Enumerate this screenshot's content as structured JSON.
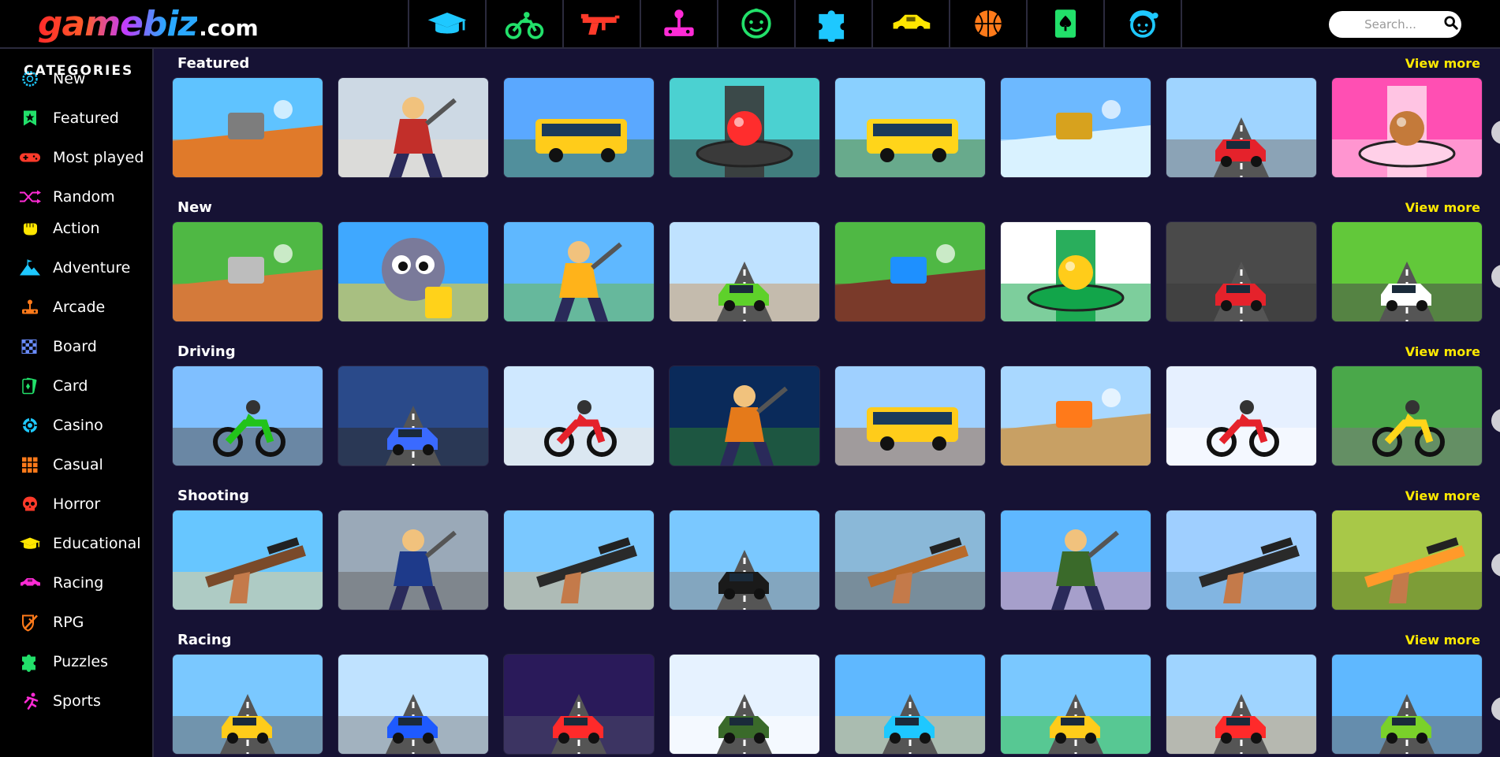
{
  "brand": {
    "name": "gamebiz",
    "suffix": ".com"
  },
  "top_nav": [
    {
      "name": "educational",
      "icon": "graduation-cap-icon",
      "color": "#1ec8ff"
    },
    {
      "name": "driving",
      "icon": "motorbike-icon",
      "color": "#22e06a"
    },
    {
      "name": "shooting",
      "icon": "gun-icon",
      "color": "#ff3a2a"
    },
    {
      "name": "arcade",
      "icon": "joystick-icon",
      "color": "#ff2bd6"
    },
    {
      "name": "kids",
      "icon": "baby-face-icon",
      "color": "#22e06a"
    },
    {
      "name": "puzzles",
      "icon": "puzzle-icon",
      "color": "#1ec8ff"
    },
    {
      "name": "racing",
      "icon": "car-icon",
      "color": "#ffe600"
    },
    {
      "name": "sports",
      "icon": "basketball-icon",
      "color": "#ff7a1a"
    },
    {
      "name": "card",
      "icon": "card-spade-icon",
      "color": "#22e06a"
    },
    {
      "name": "girls",
      "icon": "girl-face-icon",
      "color": "#1ec8ff"
    }
  ],
  "search": {
    "placeholder": "Search..."
  },
  "sidebar": {
    "title": "CATEGORIES",
    "items": [
      {
        "label": "New",
        "icon": "new-badge-icon",
        "color": "#1ec8ff"
      },
      {
        "label": "Featured",
        "icon": "bookmark-star-icon",
        "color": "#22e06a"
      },
      {
        "label": "Most played",
        "icon": "gamepad-icon",
        "color": "#ff3a2a"
      },
      {
        "label": "Random",
        "icon": "shuffle-icon",
        "color": "#ff2bd6"
      },
      {
        "label": "Action",
        "icon": "fist-icon",
        "color": "#ffe600"
      },
      {
        "label": "Adventure",
        "icon": "mountain-flag-icon",
        "color": "#1ec8ff"
      },
      {
        "label": "Arcade",
        "icon": "joystick-icon",
        "color": "#ff7a1a"
      },
      {
        "label": "Board",
        "icon": "chessboard-icon",
        "color": "#6a8cff"
      },
      {
        "label": "Card",
        "icon": "cards-icon",
        "color": "#22e06a"
      },
      {
        "label": "Casino",
        "icon": "casino-chip-icon",
        "color": "#1ec8ff"
      },
      {
        "label": "Casual",
        "icon": "grid-icon",
        "color": "#ff7a1a"
      },
      {
        "label": "Horror",
        "icon": "skull-icon",
        "color": "#ff3a2a"
      },
      {
        "label": "Educational",
        "icon": "graduation-cap-icon",
        "color": "#ffe600"
      },
      {
        "label": "Racing",
        "icon": "car-icon",
        "color": "#ff2bd6"
      },
      {
        "label": "RPG",
        "icon": "shield-sword-icon",
        "color": "#ff7a1a"
      },
      {
        "label": "Puzzles",
        "icon": "puzzle-icon",
        "color": "#22e06a"
      },
      {
        "label": "Sports",
        "icon": "runner-icon",
        "color": "#ff2bd6"
      }
    ]
  },
  "sections": [
    {
      "title": "Featured",
      "view_more": "View more",
      "games": [
        {
          "scene": "ground",
          "sky": "#5fc3ff",
          "base": "#e07a2a",
          "accent": "#7d7d7d"
        },
        {
          "scene": "hero",
          "sky": "#cdd9e4",
          "base": "#e7dcd0",
          "accent": "#c22f2a"
        },
        {
          "scene": "bus",
          "sky": "#5aa8ff",
          "base": "#4a7a4a",
          "accent": "#ffcc1a"
        },
        {
          "scene": "ball",
          "sky": "#4bd1d1",
          "base": "#3a3a3a",
          "accent": "#ff2d2d"
        },
        {
          "scene": "bus",
          "sky": "#8ad0ff",
          "base": "#4c8b2e",
          "accent": "#ffd51a"
        },
        {
          "scene": "ground",
          "sky": "#6db9ff",
          "base": "#d9f2ff",
          "accent": "#d7a21e"
        },
        {
          "scene": "car",
          "sky": "#9fd4ff",
          "base": "#7a7a7a",
          "accent": "#e5222b"
        },
        {
          "scene": "ball",
          "sky": "#ff4fb3",
          "base": "#ffd0e8",
          "accent": "#c47a3a"
        }
      ]
    },
    {
      "title": "New",
      "view_more": "View more",
      "games": [
        {
          "scene": "ground",
          "sky": "#4fb844",
          "base": "#d47a3a",
          "accent": "#bdbdbd"
        },
        {
          "scene": "face",
          "sky": "#3fa8ff",
          "base": "#ffd21a",
          "accent": "#7a7a9a"
        },
        {
          "scene": "hero",
          "sky": "#5fb8ff",
          "base": "#6cb84a",
          "accent": "#ffb31a"
        },
        {
          "scene": "car",
          "sky": "#bfe2ff",
          "base": "#c89a6a",
          "accent": "#5ed12a"
        },
        {
          "scene": "ground",
          "sky": "#4fb844",
          "base": "#7a3a2a",
          "accent": "#1e90ff"
        },
        {
          "scene": "ball",
          "sky": "#ffffff",
          "base": "#12a54a",
          "accent": "#ffcc1a"
        },
        {
          "scene": "car",
          "sky": "#4a4a4a",
          "base": "#3a3a3a",
          "accent": "#e5222b"
        },
        {
          "scene": "car",
          "sky": "#62c83a",
          "base": "#4a4a4a",
          "accent": "#ffffff"
        }
      ]
    },
    {
      "title": "Driving",
      "view_more": "View more",
      "games": [
        {
          "scene": "bike",
          "sky": "#7fbfff",
          "base": "#5a5a5a",
          "accent": "#22c31a"
        },
        {
          "scene": "car",
          "sky": "#2a4a8a",
          "base": "#2a2a2a",
          "accent": "#3a6aff"
        },
        {
          "scene": "bike",
          "sky": "#cfe8ff",
          "base": "#e6e6e6",
          "accent": "#e5222b"
        },
        {
          "scene": "hero",
          "sky": "#0a2a5a",
          "base": "#2e7a2e",
          "accent": "#e57a1a"
        },
        {
          "scene": "bus",
          "sky": "#9fd0ff",
          "base": "#a0704a",
          "accent": "#ffcc1a"
        },
        {
          "scene": "ground",
          "sky": "#a9d8ff",
          "base": "#c8a064",
          "accent": "#ff7a1a"
        },
        {
          "scene": "bike",
          "sky": "#e6f0ff",
          "base": "#ffffff",
          "accent": "#e5222b"
        },
        {
          "scene": "bike",
          "sky": "#4aa84a",
          "base": "#7a7a7a",
          "accent": "#ffd51a"
        }
      ]
    },
    {
      "title": "Shooting",
      "view_more": "View more",
      "games": [
        {
          "scene": "gun",
          "sky": "#67c6ff",
          "base": "#e9cf93",
          "accent": "#7a4a2a"
        },
        {
          "scene": "hero",
          "sky": "#9aa9b8",
          "base": "#6a6a6a",
          "accent": "#1e3a8a"
        },
        {
          "scene": "gun",
          "sky": "#7ac8ff",
          "base": "#d9b07a",
          "accent": "#2a2a2a"
        },
        {
          "scene": "car",
          "sky": "#7ac8ff",
          "base": "#8a8a8a",
          "accent": "#1a1a1a"
        },
        {
          "scene": "gun",
          "sky": "#8ab8d8",
          "base": "#6a6a6a",
          "accent": "#b86a2a"
        },
        {
          "scene": "hero",
          "sky": "#5fb8ff",
          "base": "#e08aa0",
          "accent": "#3a6a2a"
        },
        {
          "scene": "gun",
          "sky": "#9fcfff",
          "base": "#6aa0c8",
          "accent": "#2a2a2a"
        },
        {
          "scene": "gun",
          "sky": "#a8c848",
          "base": "#5a7a2a",
          "accent": "#ff9a2a"
        }
      ]
    },
    {
      "title": "Racing",
      "view_more": "View more",
      "games": [
        {
          "scene": "car",
          "sky": "#7ac8ff",
          "base": "#6a6a6a",
          "accent": "#ffcc1a"
        },
        {
          "scene": "car",
          "sky": "#bfe2ff",
          "base": "#8a8a8a",
          "accent": "#1e5aff"
        },
        {
          "scene": "car",
          "sky": "#2a1a5a",
          "base": "#4a4a6a",
          "accent": "#ff2a2a"
        },
        {
          "scene": "car",
          "sky": "#e6f2ff",
          "base": "#ffffff",
          "accent": "#3a6a2a"
        },
        {
          "scene": "car",
          "sky": "#5fb8ff",
          "base": "#e8c070",
          "accent": "#1ec8ff"
        },
        {
          "scene": "car",
          "sky": "#7ac8ff",
          "base": "#3ac83a",
          "accent": "#ffcc1a"
        },
        {
          "scene": "car",
          "sky": "#9fd4ff",
          "base": "#c8a070",
          "accent": "#ff2a2a"
        },
        {
          "scene": "car",
          "sky": "#5fb8ff",
          "base": "#6a6a6a",
          "accent": "#7ad12a"
        }
      ]
    }
  ]
}
